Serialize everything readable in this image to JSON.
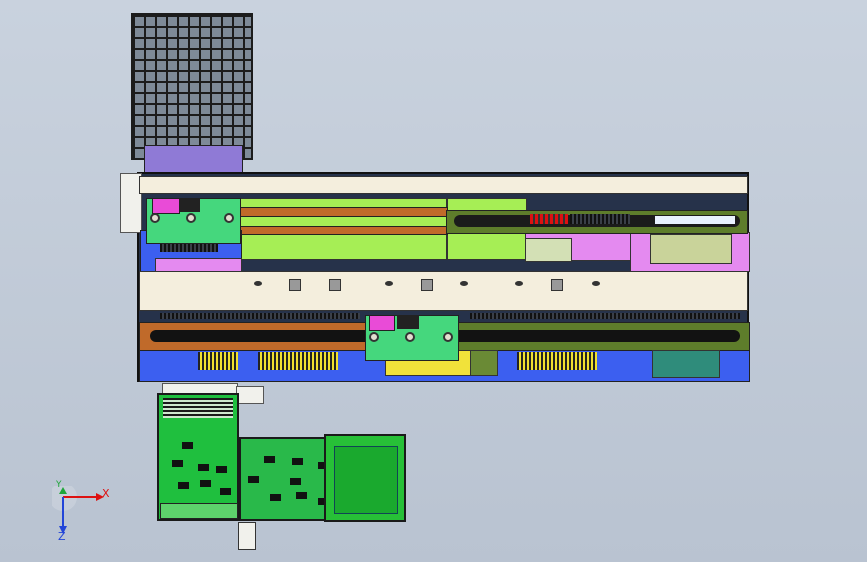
{
  "viewport": {
    "background": "#c3ccd8"
  },
  "model": {
    "grid_tray": {
      "color": "#7e8a98"
    },
    "main_frame": {
      "color": "#26324a"
    },
    "colors": {
      "rail": "#f4eedd",
      "belt_brown": "#c06a2a",
      "belt_green": "#5e7d2b",
      "lime": "#a6ee55",
      "magenta": "#e48af0",
      "blue": "#3c5ff0",
      "plate": "#45d77d",
      "bin": "#1fbf3e"
    }
  },
  "axes": {
    "x_label": "X",
    "y_label": "Y",
    "z_label": "Z"
  }
}
